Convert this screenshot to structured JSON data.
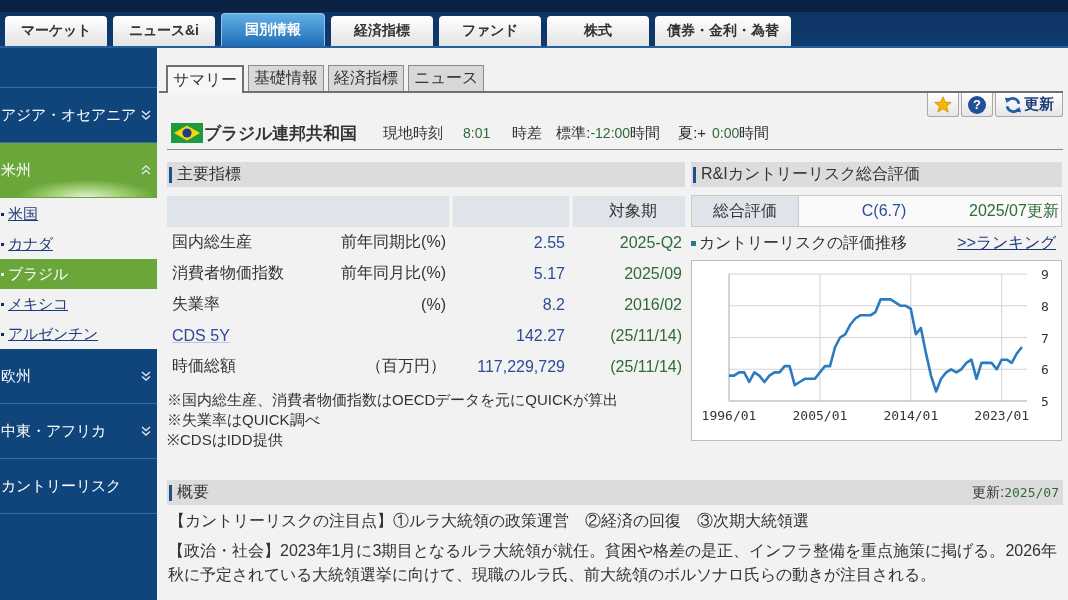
{
  "nav_tabs": [
    {
      "label": "マーケット",
      "selected": false
    },
    {
      "label": "ニュース&i",
      "selected": false
    },
    {
      "label": "国別情報",
      "selected": true
    },
    {
      "label": "経済指標",
      "selected": false
    },
    {
      "label": "ファンド",
      "selected": false
    },
    {
      "label": "株式",
      "selected": false
    },
    {
      "label": "債券・金利・為替",
      "selected": false
    }
  ],
  "sidebar": {
    "items": [
      {
        "kind": "group",
        "label": "アジア・オセアニア",
        "expanded": false,
        "selected": false
      },
      {
        "kind": "group",
        "label": "米州",
        "expanded": true,
        "selected": true,
        "children": [
          {
            "label": "米国",
            "selected": false
          },
          {
            "label": "カナダ",
            "selected": false
          },
          {
            "label": "ブラジル",
            "selected": true
          },
          {
            "label": "メキシコ",
            "selected": false
          },
          {
            "label": "アルゼンチン",
            "selected": false
          }
        ]
      },
      {
        "kind": "group",
        "label": "欧州",
        "expanded": false,
        "selected": false
      },
      {
        "kind": "group",
        "label": "中東・アフリカ",
        "expanded": false,
        "selected": false
      },
      {
        "kind": "link",
        "label": "カントリーリスク",
        "selected": false
      }
    ]
  },
  "content_tabs": [
    {
      "label": "サマリー",
      "selected": true
    },
    {
      "label": "基礎情報",
      "selected": false
    },
    {
      "label": "経済指標",
      "selected": false
    },
    {
      "label": "ニュース",
      "selected": false
    }
  ],
  "toolbar": {
    "help_button": "?",
    "refresh_button": "更新"
  },
  "country": {
    "name": "ブラジル連邦共和国",
    "local_time_label": "現地時刻",
    "local_time": "8:01",
    "time_difference_label": "時差",
    "standard": {
      "label": "標準:",
      "value": "-12:00",
      "unit": "時間"
    },
    "summer": {
      "label": "夏:+",
      "value": "0:00",
      "unit": "時間"
    }
  },
  "indicators": {
    "title": "主要指標",
    "period_header": "対象期",
    "rows": [
      {
        "kind": "text",
        "name": "国内総生産",
        "unit": "前年同期比(%)",
        "value": "2.55",
        "period": "2025-Q2"
      },
      {
        "kind": "text",
        "name": "消費者物価指数",
        "unit": "前年同月比(%)",
        "value": "5.17",
        "period": "2025/09"
      },
      {
        "kind": "text",
        "name": "失業率",
        "unit": "(%)",
        "value": "8.2",
        "period": "2016/02"
      },
      {
        "kind": "link",
        "name": "CDS 5Y",
        "value": "142.27",
        "period": "(25/11/14)"
      },
      {
        "kind": "text",
        "name": "時価総額",
        "unit": "（百万円）",
        "value": "117,229,729",
        "period": "(25/11/14)"
      }
    ],
    "notes": [
      "※国内総生産、消費者物価指数はOECDデータを元にQUICKが算出",
      "※失業率はQUICK調べ",
      "※CDSはIDD提供"
    ]
  },
  "risk": {
    "title": "R&Iカントリーリスク総合評価",
    "rating_label": "総合評価",
    "rating": "C(6.7)",
    "rating_updated": "2025/07更新",
    "ranking_link": ">>ランキング",
    "chart_data": {
      "type": "line",
      "title": "カントリーリスクの評価推移",
      "categories": [
        "1996/01",
        null,
        null,
        null,
        null,
        null,
        null,
        null,
        null,
        null,
        null,
        null,
        null,
        null,
        null,
        null,
        null,
        null,
        "2005/01",
        null,
        null,
        null,
        null,
        null,
        null,
        null,
        null,
        null,
        null,
        null,
        null,
        null,
        null,
        null,
        null,
        null,
        "2014/01",
        null,
        null,
        null,
        null,
        null,
        null,
        null,
        null,
        null,
        null,
        null,
        null,
        null,
        null,
        null,
        null,
        null,
        "2023/01",
        null,
        null,
        null,
        null
      ],
      "series": [
        {
          "color": "#2b7bbf",
          "values": [
            5.8,
            5.8,
            5.9,
            5.9,
            5.6,
            5.9,
            5.8,
            5.6,
            5.8,
            5.9,
            5.9,
            6.1,
            6.1,
            5.5,
            5.6,
            5.7,
            5.7,
            5.7,
            5.9,
            6.1,
            6.1,
            6.7,
            7.0,
            7.1,
            7.4,
            7.6,
            7.7,
            7.7,
            7.7,
            7.8,
            8.2,
            8.2,
            8.2,
            8.1,
            8.0,
            8.0,
            7.9,
            7.1,
            7.3,
            6.5,
            5.8,
            5.3,
            5.7,
            5.9,
            6.0,
            5.9,
            6.0,
            6.2,
            6.3,
            5.7,
            6.2,
            6.2,
            6.2,
            6.0,
            6.3,
            6.3,
            6.2,
            6.5,
            6.7
          ]
        }
      ],
      "ylim": [
        5,
        9
      ],
      "yticks": [
        5,
        6,
        7,
        8,
        9
      ],
      "grid": true
    }
  },
  "overview": {
    "title": "概要",
    "updated_label": "更新:",
    "updated": "2025/07",
    "focus": "【カントリーリスクの注目点】①ルラ大統領の政策運営　②経済の回復　③次期大統領選",
    "politics": "【政治・社会】2023年1月に3期目となるルラ大統領が就任。貧困や格差の是正、インフラ整備を重点施策に掲げる。2026年秋に予定されている大統領選挙に向けて、現職のルラ氏、前大統領のボルソナロ氏らの動きが注目される。"
  }
}
